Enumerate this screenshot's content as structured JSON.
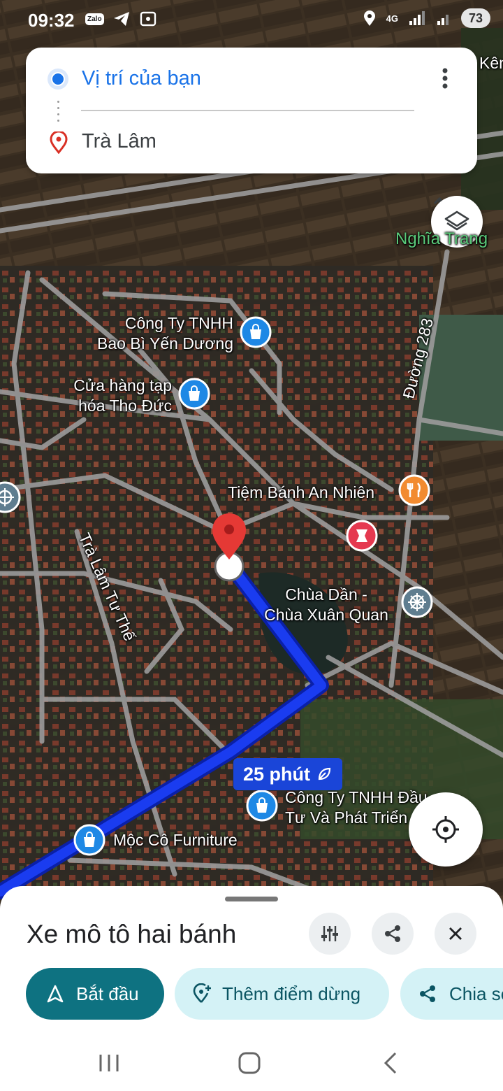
{
  "status_bar": {
    "time": "09:32",
    "zalo_label": "Zalo",
    "network_label": "4G",
    "battery": "73"
  },
  "directions": {
    "origin": "Vị trí của bạn",
    "destination": "Trà Lâm"
  },
  "map": {
    "labels": {
      "ken": "Kên",
      "nghia": "Nghĩa Trang",
      "duong283": "Đường 283",
      "tra_lam_tu_the": "Trà Lâm Tư Thế"
    },
    "pois": [
      {
        "name": "Công Ty TNHH\nBao Bì Yến Dương",
        "icon": "shopping-bag-icon",
        "color": "#1e88e5"
      },
      {
        "name": "Cửa hàng tạp\nhóa Tho Đức",
        "icon": "shopping-bag-icon",
        "color": "#1e88e5"
      },
      {
        "name": "Tiệm Bánh An Nhiên",
        "icon": "restaurant-icon",
        "color": "#f28b30"
      },
      {
        "name": "Chùa Dần -\nChùa Xuân Quan",
        "icon": "dharma-wheel-icon",
        "color": "#5f7d8f"
      },
      {
        "name": "Công Ty TNHH Đầu\nTư Và Phát Triển",
        "icon": "shopping-bag-icon",
        "color": "#1e88e5"
      },
      {
        "name": "Mộc Cô Furniture",
        "icon": "shopping-bag-icon",
        "color": "#1e88e5"
      }
    ]
  },
  "route": {
    "eta": "25 phút",
    "color": "#1a3cf0"
  },
  "sheet": {
    "mode_title": "Xe mô tô hai bánh",
    "start_label": "Bắt đầu",
    "add_stop_label": "Thêm điểm dừng",
    "share_label": "Chia sẻ"
  },
  "colors": {
    "accent": "#1a73e8",
    "start_button": "#0e7281",
    "chip_bg": "#d4f2f6",
    "pin_red": "#e53935"
  }
}
